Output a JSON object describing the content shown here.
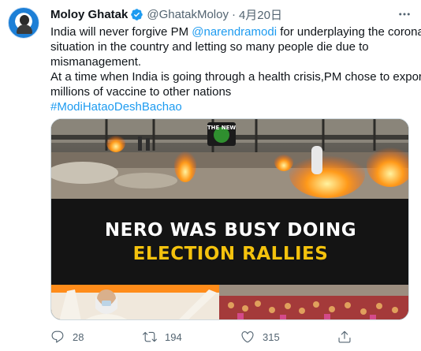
{
  "author": {
    "name": "Moloy Ghatak",
    "handle": "@GhatakMoloy",
    "separator": "·",
    "time": "4月20日"
  },
  "tweet": {
    "line1_pre": "India will never forgive PM ",
    "mention": "@narendramodi",
    "line1_post": " for underplaying the corona",
    "line2": "situation in the country and letting so many people die due to",
    "line3": "mismanagement.",
    "line4": "At a time when India is going through a health crisis,PM chose to export",
    "line5": "millions of vaccine to other nations",
    "hashtag": "#ModiHataoDeshBachao"
  },
  "media": {
    "badge_text": "THE NEW",
    "headline_line1": "NERO WAS BUSY DOING",
    "headline_line2": "ELECTION RALLIES"
  },
  "actions": {
    "replies": "28",
    "retweets": "194",
    "likes": "315"
  },
  "colors": {
    "link": "#1d9bf0",
    "verified": "#1d9bf0",
    "muted": "#536471",
    "headline_yellow": "#f4c20d"
  },
  "icons": [
    "verified-badge-icon",
    "more-icon",
    "reply-icon",
    "retweet-icon",
    "like-icon",
    "share-icon"
  ]
}
